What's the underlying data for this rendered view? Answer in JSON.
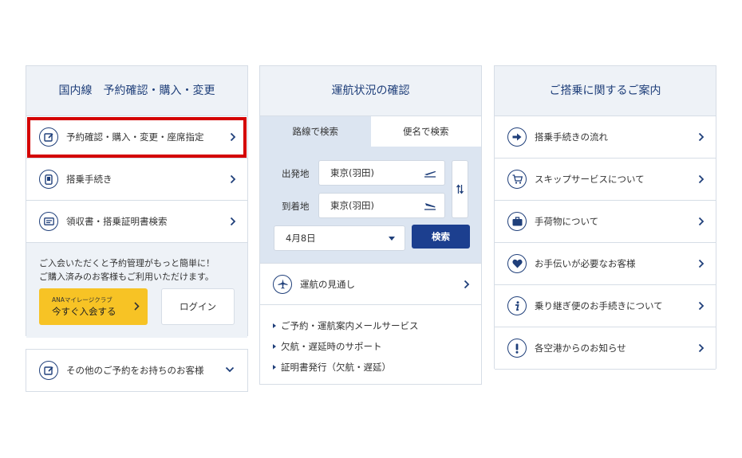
{
  "panel1": {
    "title": "国内線　予約確認・購入・変更",
    "items": [
      {
        "label": "予約確認・購入・変更・座席指定"
      },
      {
        "label": "搭乗手続き"
      },
      {
        "label": "領収書・搭乗証明書検索"
      }
    ],
    "member_text_1": "ご入会いただくと予約管理がもっと簡単に！",
    "member_text_2": "ご購入済みのお客様もご利用いただけます。",
    "join_button_small": "ANAマイレージクラブ",
    "join_button_main": "今すぐ入会する",
    "login_button": "ログイン",
    "other_label": "その他のご予約をお持ちのお客様"
  },
  "panel2": {
    "title": "運航状況の確認",
    "tabs": [
      {
        "label": "路線で検索"
      },
      {
        "label": "便名で検索"
      }
    ],
    "departure_label": "出発地",
    "departure_value": "東京(羽田)",
    "arrival_label": "到着地",
    "arrival_value": "東京(羽田)",
    "date_value": "4月8日",
    "search_button": "検索",
    "forecast_label": "運航の見通し",
    "links": [
      {
        "label": "ご予約・運航案内メールサービス"
      },
      {
        "label": "欠航・遅延時のサポート"
      },
      {
        "label": "証明書発行（欠航・遅延）"
      }
    ]
  },
  "panel3": {
    "title": "ご搭乗に関するご案内",
    "items": [
      {
        "label": "搭乗手続きの流れ"
      },
      {
        "label": "スキップサービスについて"
      },
      {
        "label": "手荷物について"
      },
      {
        "label": "お手伝いが必要なお客様"
      },
      {
        "label": "乗り継ぎ便のお手続きについて"
      },
      {
        "label": "各空港からのお知らせ"
      }
    ]
  },
  "colors": {
    "accent": "#1f3f7a",
    "highlight": "#d40000",
    "member_button": "#f7c325",
    "search_button": "#1c3f8f"
  }
}
